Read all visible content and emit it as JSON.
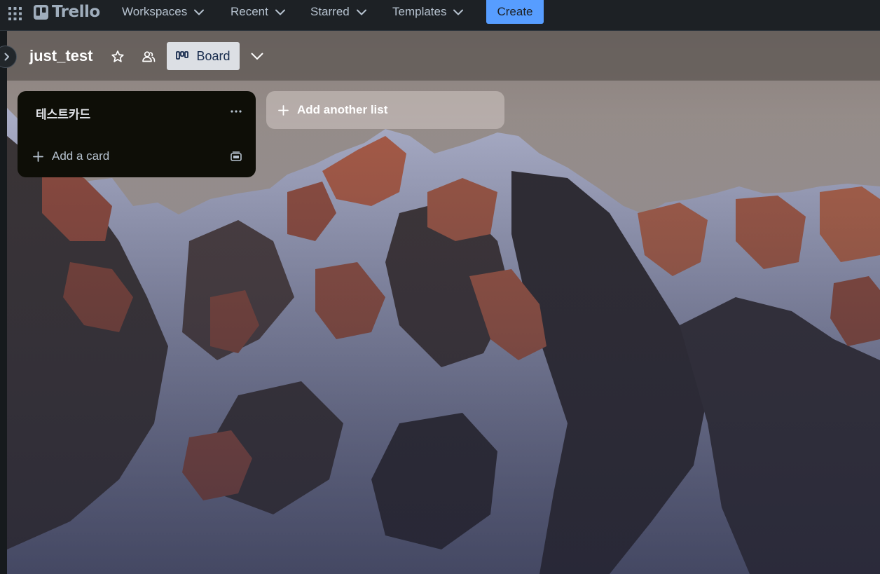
{
  "topbar": {
    "logo_text": "Trello",
    "nav": [
      {
        "label": "Workspaces"
      },
      {
        "label": "Recent"
      },
      {
        "label": "Starred"
      },
      {
        "label": "Templates"
      }
    ],
    "create_label": "Create"
  },
  "board": {
    "title": "just_test",
    "view_label": "Board",
    "lists": [
      {
        "title": "테스트카드",
        "add_card_label": "Add a card"
      }
    ],
    "add_list_label": "Add another list"
  },
  "colors": {
    "topbar_bg": "#1d2125",
    "create_button": "#579dff",
    "list_bg": "#0e0e07"
  },
  "icons": [
    "app-switcher-icon",
    "trello-logo-icon",
    "chevron-down-icon",
    "chevron-right-icon",
    "star-icon",
    "people-icon",
    "board-view-icon",
    "ellipsis-icon",
    "plus-icon",
    "card-template-icon"
  ]
}
